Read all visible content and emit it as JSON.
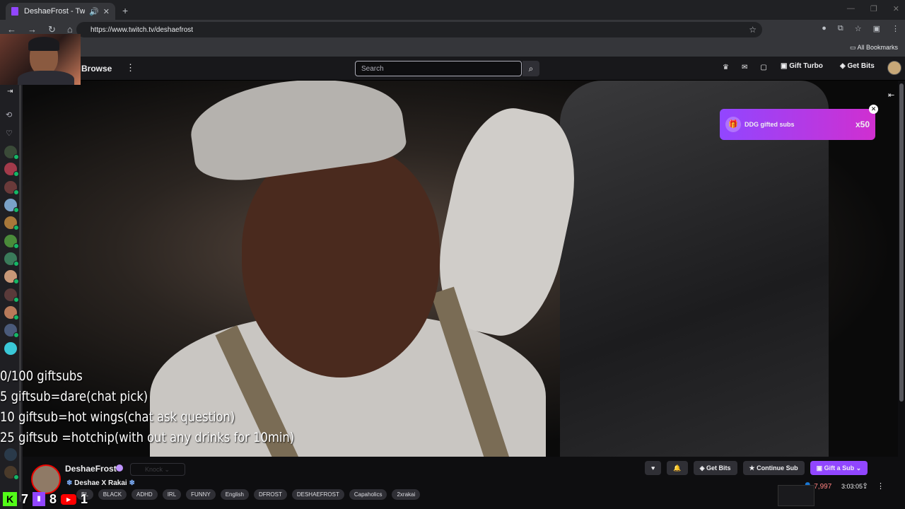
{
  "browser": {
    "tab_title": "DeshaeFrost - Twitch",
    "url": "https://www.twitch.tv/deshaefrost",
    "all_bookmarks": "All Bookmarks"
  },
  "twitch_nav": {
    "browse": "Browse",
    "search_placeholder": "Search",
    "gift_turbo": "Gift Turbo",
    "get_bits": "Get Bits"
  },
  "overlay": {
    "lines": [
      "0/100 giftsubs",
      "5 giftsub=dare(chat pick)",
      "10 giftsub=hot wings(chat ask question)",
      "25 giftsub =hotchip(with out any drinks for 10min)"
    ]
  },
  "notification": {
    "text": "DDG gifted subs",
    "count": "x50"
  },
  "channel": {
    "name": "DeshaeFrost",
    "knock": "Knock",
    "stream_title": "Deshae X Rakai",
    "tags": [
      "BL",
      "BLACK",
      "ADHD",
      "IRL",
      "FUNNY",
      "English",
      "DFROST",
      "DESHAEFROST",
      "Capaholics",
      "2xrakai"
    ],
    "get_bits": "Get Bits",
    "continue_sub": "Continue Sub",
    "gift_a_sub": "Gift a Sub",
    "viewers": "7,997",
    "uptime": "3:03:05"
  },
  "socials": {
    "kick_count": "7",
    "twitch_count": "8",
    "youtube_count": "1"
  },
  "colors": {
    "accent": "#9146ff",
    "live_red": "#eb0400",
    "notification_gradient_end": "#d02fd0"
  }
}
